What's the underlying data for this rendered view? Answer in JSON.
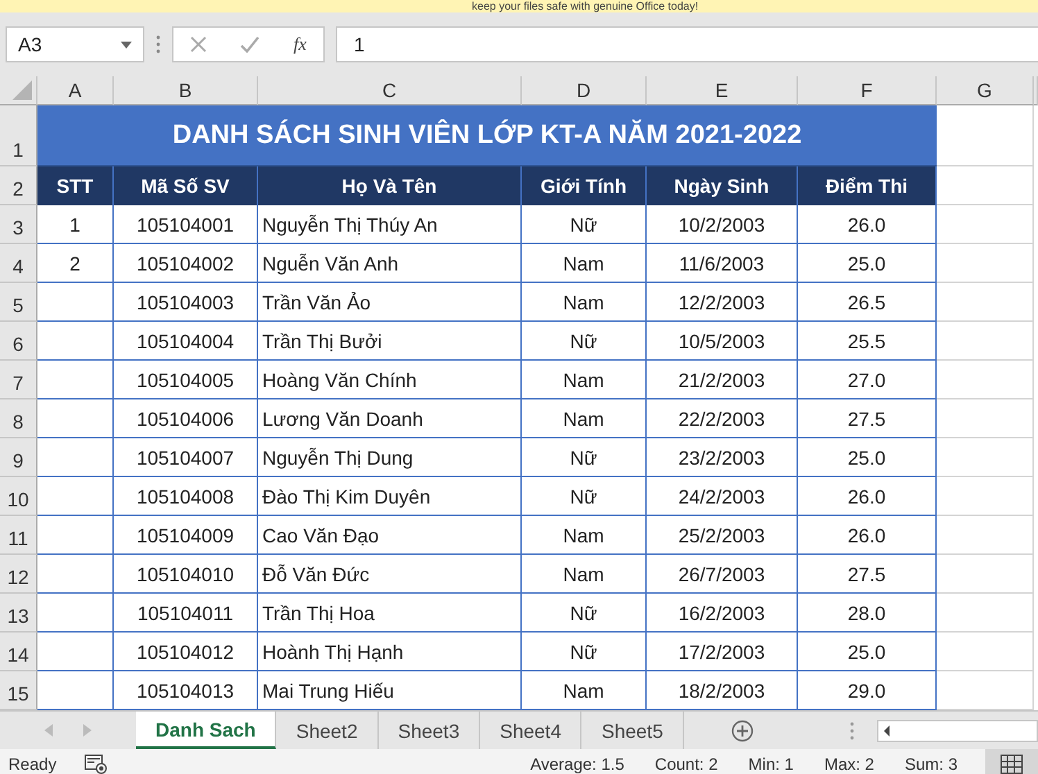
{
  "banner": {
    "text": "keep your files safe with genuine Office today!"
  },
  "formula_bar": {
    "name_box": "A3",
    "function_label": "fx",
    "value": "1"
  },
  "column_headers": [
    "A",
    "B",
    "C",
    "D",
    "E",
    "F",
    "G"
  ],
  "title_row": {
    "row_number": "1",
    "text": "DANH SÁCH SINH VIÊN LỚP KT-A NĂM 2021-2022"
  },
  "header_row": {
    "row_number": "2",
    "cells": [
      "STT",
      "Mã Số SV",
      "Họ Và Tên",
      "Giới Tính",
      "Ngày Sinh",
      "Điểm Thi"
    ]
  },
  "rows": [
    {
      "row_number": "3",
      "cells": [
        "1",
        "105104001",
        "Nguyễn Thị Thúy An",
        "Nữ",
        "10/2/2003",
        "26.0"
      ]
    },
    {
      "row_number": "4",
      "cells": [
        "2",
        "105104002",
        "Nguễn Văn Anh",
        "Nam",
        "11/6/2003",
        "25.0"
      ]
    },
    {
      "row_number": "5",
      "cells": [
        "",
        "105104003",
        "Trần Văn Ảo",
        "Nam",
        "12/2/2003",
        "26.5"
      ]
    },
    {
      "row_number": "6",
      "cells": [
        "",
        "105104004",
        "Trần Thị Bưởi",
        "Nữ",
        "10/5/2003",
        "25.5"
      ]
    },
    {
      "row_number": "7",
      "cells": [
        "",
        "105104005",
        "Hoàng Văn Chính",
        "Nam",
        "21/2/2003",
        "27.0"
      ]
    },
    {
      "row_number": "8",
      "cells": [
        "",
        "105104006",
        "Lương Văn Doanh",
        "Nam",
        "22/2/2003",
        "27.5"
      ]
    },
    {
      "row_number": "9",
      "cells": [
        "",
        "105104007",
        "Nguyễn Thị Dung",
        "Nữ",
        "23/2/2003",
        "25.0"
      ]
    },
    {
      "row_number": "10",
      "cells": [
        "",
        "105104008",
        "Đào Thị Kim Duyên",
        "Nữ",
        "24/2/2003",
        "26.0"
      ]
    },
    {
      "row_number": "11",
      "cells": [
        "",
        "105104009",
        "Cao Văn Đạo",
        "Nam",
        "25/2/2003",
        "26.0"
      ]
    },
    {
      "row_number": "12",
      "cells": [
        "",
        "105104010",
        "Đỗ Văn Đức",
        "Nam",
        "26/7/2003",
        "27.5"
      ]
    },
    {
      "row_number": "13",
      "cells": [
        "",
        "105104011",
        "Trần Thị Hoa",
        "Nữ",
        "16/2/2003",
        "28.0"
      ]
    },
    {
      "row_number": "14",
      "cells": [
        "",
        "105104012",
        "Hoành Thị Hạnh",
        "Nữ",
        "17/2/2003",
        "25.0"
      ]
    },
    {
      "row_number": "15",
      "cells": [
        "",
        "105104013",
        "Mai Trung Hiếu",
        "Nam",
        "18/2/2003",
        "29.0"
      ]
    }
  ],
  "sheet_tabs": [
    {
      "label": "Danh Sach",
      "selected": true
    },
    {
      "label": "Sheet2",
      "selected": false
    },
    {
      "label": "Sheet3",
      "selected": false
    },
    {
      "label": "Sheet4",
      "selected": false
    },
    {
      "label": "Sheet5",
      "selected": false
    }
  ],
  "status_bar": {
    "status": "Ready",
    "stats": [
      "Average: 1.5",
      "Count: 2",
      "Min: 1",
      "Max: 2",
      "Sum: 3"
    ]
  }
}
